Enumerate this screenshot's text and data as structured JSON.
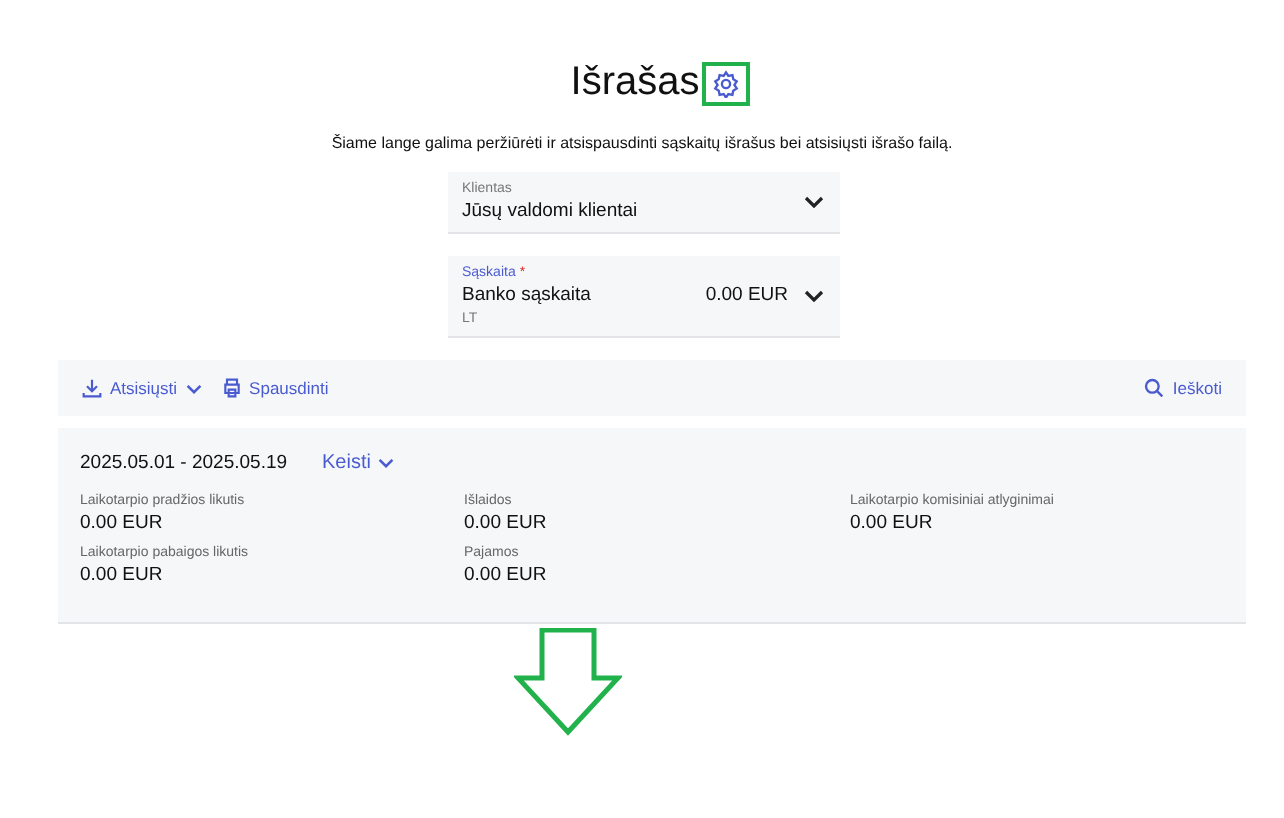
{
  "page": {
    "title": "Išrašas",
    "description": "Šiame lange galima peržiūrėti ir atsispausdinti sąskaitų išrašus bei atsisiųsti išrašo failą."
  },
  "fields": [
    {
      "kind": "select",
      "label": "Klientas",
      "value": "Jūsų valdomi klientai"
    },
    {
      "kind": "account",
      "label": "Sąskaita",
      "required_mark": "*",
      "value": "Banko sąskaita",
      "amount": "0.00 EUR",
      "subtext": "LT"
    }
  ],
  "toolbar": {
    "download": "Atsisiųsti",
    "print": "Spausdinti",
    "search": "Ieškoti"
  },
  "summary": {
    "period": "2025.05.01 - 2025.05.19",
    "change": "Keisti",
    "stats": [
      {
        "label": "Laikotarpio pradžios likutis",
        "value": "0.00 EUR"
      },
      {
        "label": "Išlaidos",
        "value": "0.00 EUR"
      },
      {
        "label": "Laikotarpio komisiniai atlyginimai",
        "value": "0.00 EUR"
      },
      {
        "label": "Laikotarpio pabaigos likutis",
        "value": "0.00 EUR"
      },
      {
        "label": "Pajamos",
        "value": "0.00 EUR"
      }
    ]
  }
}
